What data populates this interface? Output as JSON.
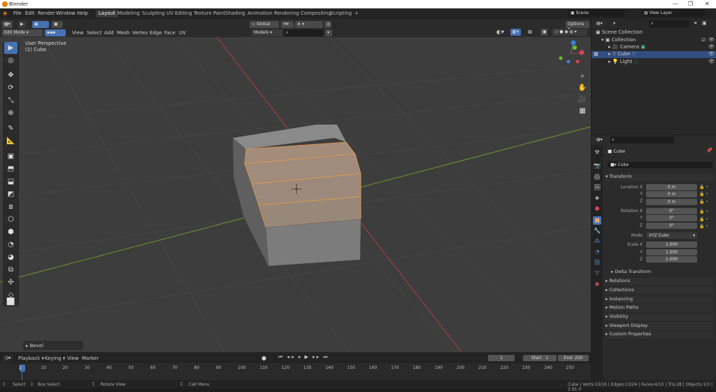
{
  "window": {
    "title": "Blender"
  },
  "menu": [
    "File",
    "Edit",
    "Render",
    "Window",
    "Help"
  ],
  "workspaces": [
    "Layout",
    "Modeling",
    "Sculpting",
    "UV Editing",
    "Texture Paint",
    "Shading",
    "Animation",
    "Rendering",
    "Compositing",
    "Scripting"
  ],
  "scene_label": "Scene",
  "view_layer_label": "View Layer",
  "header": {
    "mode": "Edit Mode",
    "menus": [
      "View",
      "Select",
      "Add",
      "Mesh",
      "Vertex",
      "Edge",
      "Face",
      "UV"
    ],
    "orientation": "Global",
    "options": "Options",
    "models": "Models"
  },
  "viewport": {
    "perspective": "User Perspective",
    "object": "(1) Cube"
  },
  "operator_panel": "Bevel",
  "outliner": {
    "items": [
      "Scene Collection",
      "Collection",
      "Camera",
      "Cube",
      "Light"
    ]
  },
  "properties": {
    "object_name": "Cube",
    "data_name": "Cube",
    "transform": "Transform",
    "location": {
      "label": "Location X",
      "y": "Y",
      "z": "Z",
      "values": [
        "0 m",
        "0 m",
        "0 m"
      ]
    },
    "rotation": {
      "label": "Rotation X",
      "y": "Y",
      "z": "Z",
      "values": [
        "0°",
        "0°",
        "0°"
      ]
    },
    "mode_label": "Mode",
    "mode_value": "XYZ Euler",
    "scale": {
      "label": "Scale X",
      "y": "Y",
      "z": "Z",
      "values": [
        "1.000",
        "1.000",
        "1.000"
      ]
    },
    "delta": "Delta Transform",
    "sections": [
      "Relations",
      "Collections",
      "Instancing",
      "Motion Paths",
      "Visibility",
      "Viewport Display",
      "Custom Properties"
    ]
  },
  "timeline": {
    "menus": [
      "Playback",
      "Keying",
      "View",
      "Marker"
    ],
    "current": "1",
    "start_label": "Start",
    "start": "1",
    "end_label": "End",
    "end": "250",
    "frames": [
      "1",
      "10",
      "20",
      "30",
      "40",
      "50",
      "60",
      "70",
      "80",
      "90",
      "100",
      "110",
      "120",
      "130",
      "140",
      "150",
      "160",
      "170",
      "180",
      "190",
      "200",
      "210",
      "220",
      "230",
      "240",
      "250"
    ]
  },
  "status": {
    "select": "Select",
    "box": "Box Select",
    "rotate": "Rotate View",
    "menu": "Call Menu",
    "stats": "Cube | Verts:10/16 | Edges:13/24 | Faces:4/10 | Tris:28 | Objects:1/3 | 2.91.0"
  },
  "colors": {
    "accent": "#4772b3",
    "selection": "#e89a48",
    "x_axis": "#b23a48",
    "y_axis": "#6d9a2d"
  }
}
